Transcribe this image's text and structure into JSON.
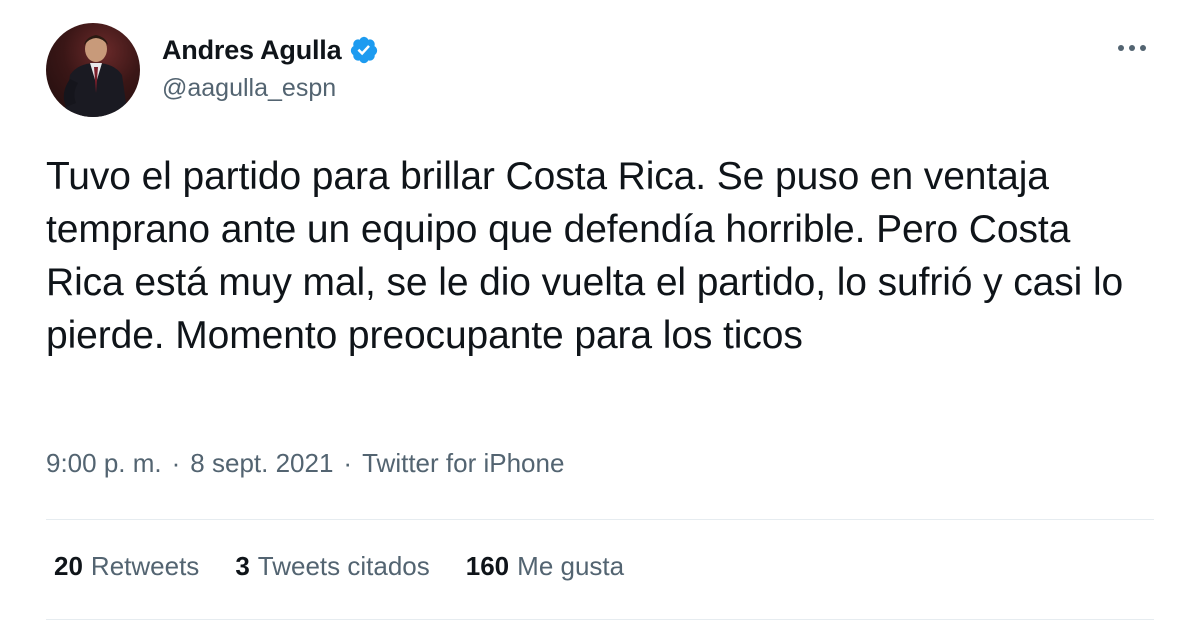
{
  "author": {
    "name": "Andres Agulla",
    "handle": "@aagulla_espn",
    "verified": true
  },
  "tweet": {
    "text": "Tuvo el partido para brillar Costa Rica. Se puso en ventaja temprano ante un equipo que defendía horrible. Pero Costa Rica está muy mal, se le dio vuelta el partido, lo sufrió y casi lo pierde. Momento preocupante para los ticos"
  },
  "meta": {
    "time": "9:00 p. m.",
    "separator1": "·",
    "date": "8 sept. 2021",
    "separator2": "·",
    "source": "Twitter for iPhone"
  },
  "stats": {
    "retweets_count": "20",
    "retweets_label": "Retweets",
    "quotes_count": "3",
    "quotes_label": "Tweets citados",
    "likes_count": "160",
    "likes_label": "Me gusta"
  },
  "colors": {
    "primary_text": "#0f1419",
    "secondary_text": "#536471",
    "verified_blue": "#1d9bf0",
    "divider": "#e6ecf0"
  },
  "icons": {
    "verified": "verified-badge-icon",
    "more": "more-dots-icon"
  }
}
